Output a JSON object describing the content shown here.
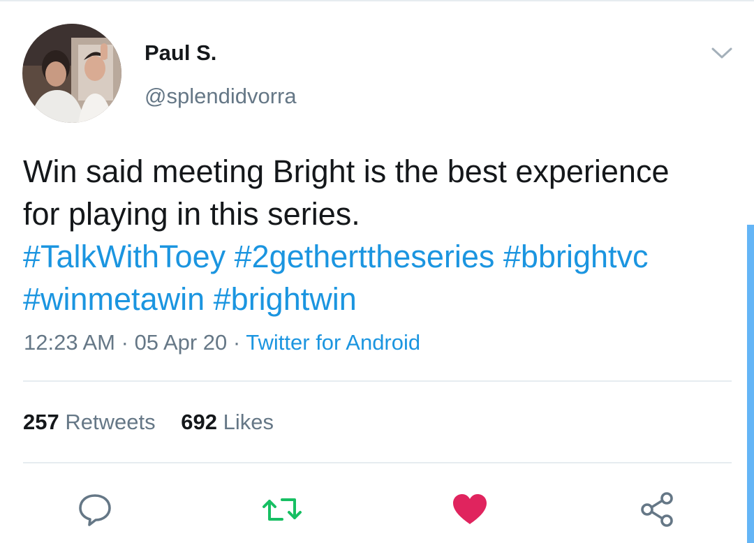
{
  "tweet": {
    "author": {
      "display_name": "Paul S.",
      "handle": "@splendidvorra"
    },
    "text_lines": [
      "Win said meeting Bright is the best experience",
      "for playing in this series."
    ],
    "hashtags": [
      "#TalkWithToey",
      "#2getherttheseries",
      "#bbrightvc",
      "#winmetawin",
      "#brightwin"
    ],
    "time": "12:23 AM",
    "date": "05 Apr 20",
    "separator": "·",
    "source": "Twitter for Android"
  },
  "stats": {
    "retweets_count": "257",
    "retweets_label": "Retweets",
    "likes_count": "692",
    "likes_label": "Likes"
  },
  "actions": {
    "reply_icon": "comment-icon",
    "retweet_icon": "retweet-icon",
    "like_icon": "heart-icon",
    "share_icon": "share-icon",
    "retweet_color": "#17bf63",
    "like_color": "#e0245e"
  },
  "colors": {
    "link": "#1b95e0",
    "secondary_text": "#657786",
    "primary_text": "#14171a",
    "divider": "#e6ecf0",
    "scrollbar": "#64b5f6"
  }
}
